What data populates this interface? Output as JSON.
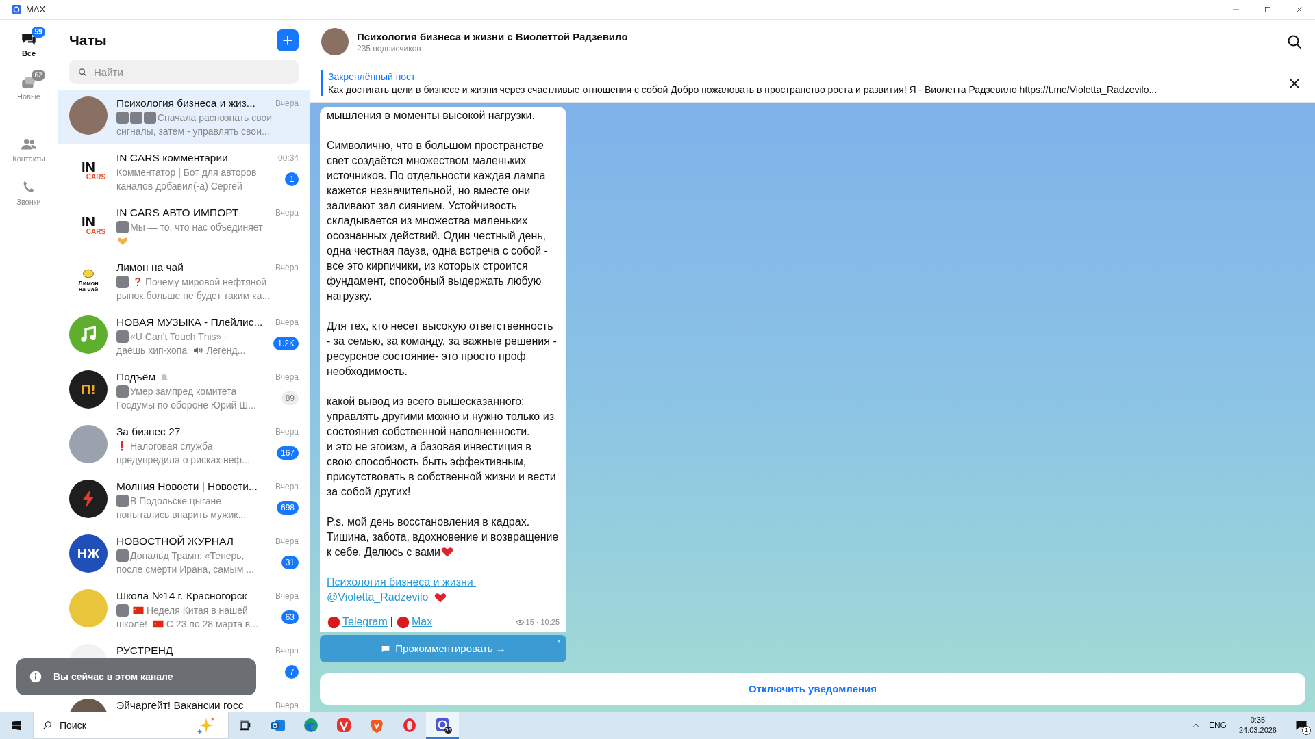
{
  "window": {
    "title": "MAX"
  },
  "rail": [
    {
      "kind": "all",
      "label": "Все",
      "badge": "59",
      "selected": true
    },
    {
      "kind": "new",
      "label": "Новые",
      "badge": "62",
      "selected": false
    },
    {
      "kind": "contacts",
      "label": "Контакты",
      "selected": false
    },
    {
      "kind": "calls",
      "label": "Звонки",
      "selected": false
    }
  ],
  "chat_list": {
    "title": "Чаты",
    "search": {
      "placeholder": "Найти"
    },
    "chats": [
      {
        "name": "Психология бизнеса и жиз...",
        "time": "Вчера",
        "selected": true,
        "avatar": {
          "kind": "photo",
          "color": "#8a6f63"
        },
        "preview": [
          [
            {
              "kind": "thumb"
            },
            {
              "kind": "thumb"
            },
            {
              "kind": "thumb"
            },
            {
              "kind": "text",
              "text": "Сначала распознать свои"
            }
          ],
          [
            {
              "kind": "text",
              "text": "сигналы, затем - управлять свои..."
            }
          ]
        ]
      },
      {
        "name": "IN CARS комментарии",
        "time": "00:34",
        "selected": false,
        "badge": "1",
        "muted": false,
        "avatar": {
          "kind": "logo",
          "color": "#ffffff",
          "text": [
            "IN",
            "CARS"
          ]
        },
        "preview": [
          [
            {
              "kind": "text",
              "text": "Комментатор | Бот для авторов"
            }
          ],
          [
            {
              "kind": "text",
              "text": "каналов добавил(-а) Сергей"
            }
          ]
        ]
      },
      {
        "name": "IN CARS АВТО ИМПОРТ",
        "time": "Вчера",
        "selected": false,
        "avatar": {
          "kind": "logo",
          "color": "#ffffff",
          "text": [
            "IN",
            "CARS"
          ]
        },
        "preview": [
          [
            {
              "kind": "thumb"
            },
            {
              "kind": "text",
              "text": "Мы — то, что нас объединяет"
            }
          ],
          [
            {
              "kind": "hands"
            }
          ]
        ]
      },
      {
        "name": "Лимон на чай",
        "time": "Вчера",
        "selected": false,
        "avatar": {
          "kind": "lemon",
          "color": "#ffffff",
          "text": [
            "Лимон",
            "на чай"
          ]
        },
        "preview": [
          [
            {
              "kind": "thumb"
            },
            {
              "kind": "question"
            },
            {
              "kind": "text",
              "text": "Почему мировой нефтяной"
            }
          ],
          [
            {
              "kind": "text",
              "text": "рынок больше не будет таким ка..."
            }
          ]
        ]
      },
      {
        "name": "НОВАЯ МУЗЫКА - Плейлис...",
        "time": "Вчера",
        "selected": false,
        "badge": "1.2K",
        "muted": false,
        "avatar": {
          "kind": "music",
          "color": "#5fae2e"
        },
        "preview": [
          [
            {
              "kind": "thumb"
            },
            {
              "kind": "text",
              "text": "«U Can’t Touch This» -"
            }
          ],
          [
            {
              "kind": "text",
              "text": "даёшь хип-хопа"
            },
            {
              "kind": "speaker"
            },
            {
              "kind": "text",
              "text": "Легенд..."
            }
          ]
        ]
      },
      {
        "name": "Подъём",
        "time": "Вчера",
        "selected": false,
        "badge": "89",
        "muted": true,
        "avatar": {
          "kind": "logo",
          "color": "#1e1e1e",
          "text": [
            "П!"
          ]
        },
        "preview": [
          [
            {
              "kind": "thumb"
            },
            {
              "kind": "text",
              "text": "Умер зампред комитета"
            }
          ],
          [
            {
              "kind": "text",
              "text": "Госдумы по обороне Юрий Ш..."
            }
          ]
        ]
      },
      {
        "name": "За бизнес 27",
        "time": "Вчера",
        "selected": false,
        "badge": "167",
        "muted": false,
        "avatar": {
          "kind": "photo",
          "color": "#9aa3ad"
        },
        "preview": [
          [
            {
              "kind": "exclamation"
            },
            {
              "kind": "text",
              "text": "Налоговая служба"
            }
          ],
          [
            {
              "kind": "text",
              "text": "предупредила о рисках неф..."
            }
          ]
        ]
      },
      {
        "name": "Молния Новости | Новости...",
        "time": "Вчера",
        "selected": false,
        "badge": "698",
        "muted": false,
        "avatar": {
          "kind": "bolt",
          "color": "#1e1e1e"
        },
        "preview": [
          [
            {
              "kind": "thumb"
            },
            {
              "kind": "text",
              "text": "В Подольске цыгане"
            }
          ],
          [
            {
              "kind": "text",
              "text": "попытались впарить мужик..."
            }
          ]
        ]
      },
      {
        "name": "НОВОСТНОЙ ЖУРНАЛ",
        "time": "Вчера",
        "selected": false,
        "badge": "31",
        "muted": false,
        "avatar": {
          "kind": "logo",
          "color": "#1f4fb8",
          "text": [
            "НЖ"
          ]
        },
        "preview": [
          [
            {
              "kind": "thumb"
            },
            {
              "kind": "text",
              "text": "Дональд Трамп: «Теперь,"
            }
          ],
          [
            {
              "kind": "text",
              "text": "после смерти Ирана, самым ..."
            }
          ]
        ]
      },
      {
        "name": "Школа №14 г. Красногорск",
        "time": "Вчера",
        "selected": false,
        "badge": "63",
        "muted": false,
        "avatar": {
          "kind": "photo",
          "color": "#e8c53a"
        },
        "preview": [
          [
            {
              "kind": "thumb"
            },
            {
              "kind": "flag"
            },
            {
              "kind": "text",
              "text": "Неделя Китая в нашей"
            }
          ],
          [
            {
              "kind": "text",
              "text": "школе!"
            },
            {
              "kind": "flag"
            },
            {
              "kind": "text",
              "text": "С 23 по 28 марта в..."
            }
          ]
        ]
      },
      {
        "name": "РУСТРЕНД",
        "time": "Вчера",
        "selected": false,
        "badge": "7",
        "muted": false,
        "avatar": {
          "kind": "photo",
          "color": "#f2f2f2"
        }
      },
      {
        "name": "Эйчаргейт! Вакансии госс",
        "time": "Вчера",
        "selected": false,
        "avatar": {
          "kind": "photo",
          "color": "#6b5a4c"
        }
      }
    ]
  },
  "channel": {
    "title": "Психология бизнеса и жизни с Виолеттой Радзевило",
    "subtitle": "235 подписчиков",
    "pinned": {
      "label": "Закреплённый пост",
      "text": "Как достигать цели в бизнесе и жизни через счастливые отношения с собой  Добро пожаловать в пространство роста и развития!  Я  - Виолетта Радзевило https://t.me/Violetta_Radzevilo..."
    },
    "message": {
      "paragraphs": [
        "мышления в моменты высокой нагрузки.",
        "Символично, что в большом пространстве свет создаётся множеством маленьких источников. По отдельности каждая лампа кажется незначительной, но вместе они заливают зал сиянием. Устойчивость складывается из множества маленьких осознанных действий. Один честный день, одна честная пауза, одна встреча с собой - все это кирпичики, из которых строится фундамент, способный выдержать любую нагрузку.",
        "Для тех, кто несет высокую ответственность - за семью, за команду, за важные решения - ресурсное состояние- это просто  проф необходимость.",
        "какой вывод из всего вышесказанного:\nуправлять другими можно и нужно только из состояния собственной наполненности.\nи это не эгоизм, а базовая инвестиция в свою способность быть эффективным, присутствовать в собственной жизни и вести за собой других!",
        "P.s. мой день восстановления в кадрах. Тишина, забота, вдохновение и возвращение к себе. Делюсь с вами"
      ],
      "signature_link": "Психология бизнеса и жизни ",
      "handle": "@Violetta_Radzevilo",
      "links": [
        "Telegram",
        "Max"
      ],
      "separator": "|",
      "views": "15",
      "meta_separator": "·",
      "time": "10:25"
    },
    "comment_button": "Прокомментировать →",
    "mute_button": "Отключить уведомления"
  },
  "toast": "Вы сейчас в этом канале",
  "taskbar": {
    "search": "Поиск",
    "apps": [
      {
        "kind": "outlook",
        "selected": false
      },
      {
        "kind": "edge",
        "selected": false
      },
      {
        "kind": "vivaldi",
        "selected": false
      },
      {
        "kind": "brave",
        "selected": false
      },
      {
        "kind": "opera",
        "selected": false
      },
      {
        "kind": "max",
        "badge": "59",
        "selected": true
      }
    ],
    "language": "ENG",
    "clock": "0:35",
    "date": "24.03.2026",
    "notifications": "1"
  }
}
